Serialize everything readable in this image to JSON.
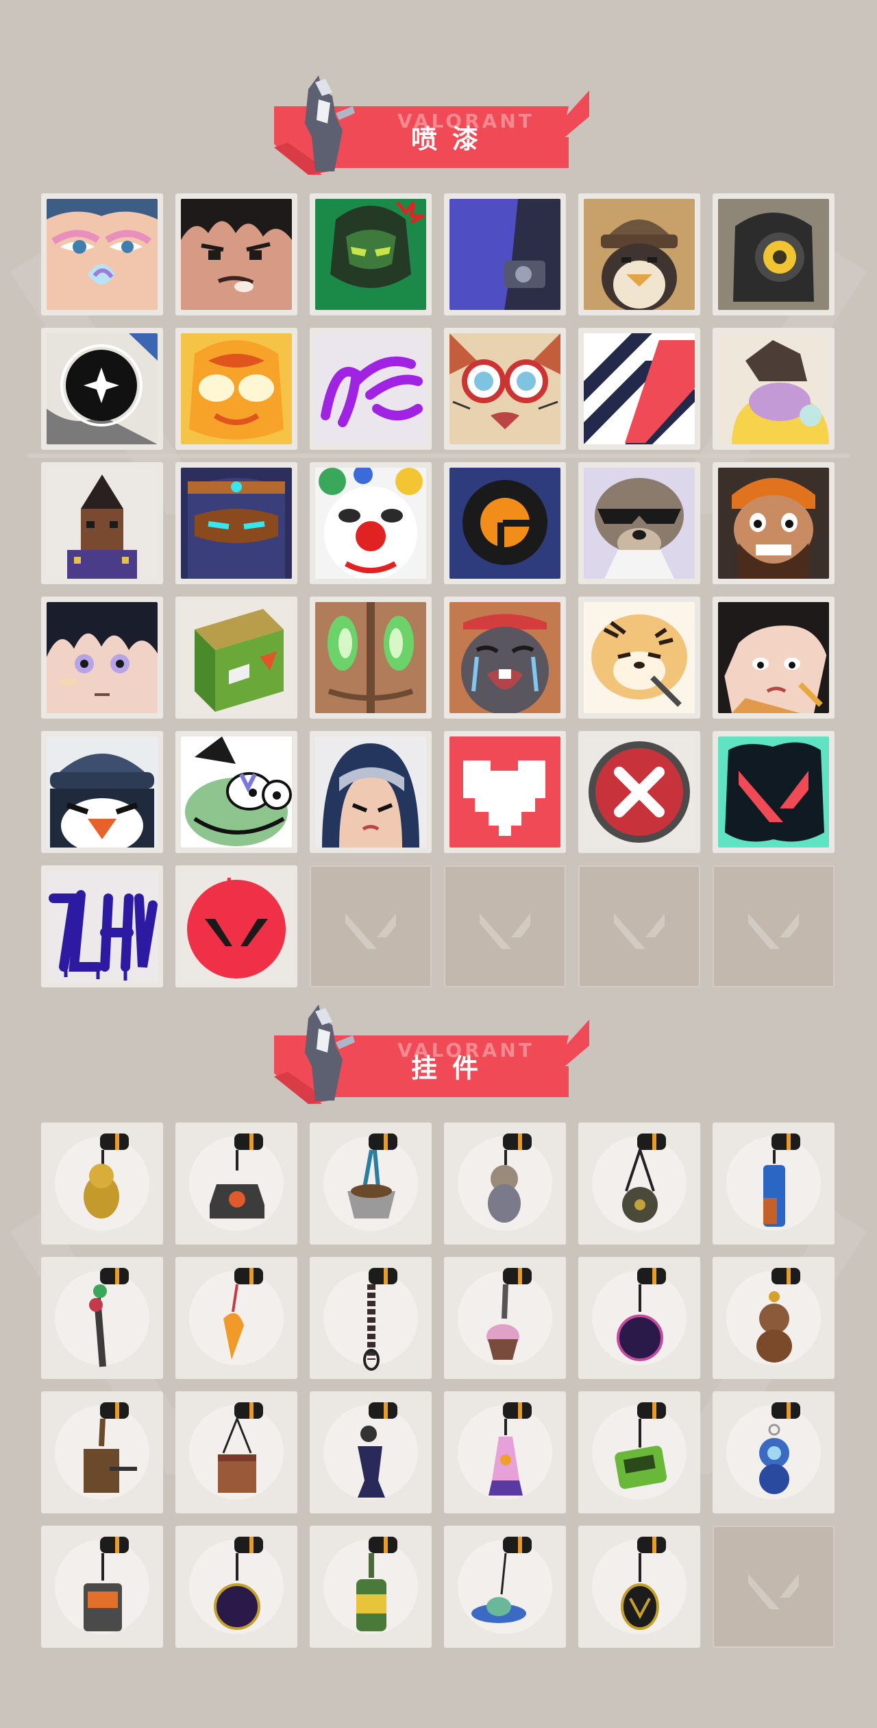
{
  "sections": {
    "sprays": {
      "title": "喷漆",
      "brand": "VALORANT"
    },
    "charms": {
      "title": "挂件",
      "brand": "VALORANT"
    }
  },
  "colors": {
    "background": "#cbc4bd",
    "accent_red": "#ef4a55",
    "tile": "#ebe7e2",
    "empty_tile": "#c2b8ad"
  },
  "sprays": [
    "sage-face-spray",
    "angry-boy-spray",
    "green-soldier-spray",
    "purple-robot-spray",
    "penguin-beanie-spray",
    "camera-bot-spray",
    "sparkle-spray",
    "flame-mask-spray",
    "purple-graffiti-spray",
    "goggles-cat-spray",
    "chevron-logo-spray",
    "sleepy-hat-spray",
    "pixel-warrior-spray",
    "visor-helmet-spray",
    "clown-face-spray",
    "top-hat-spray",
    "raccoon-shades-spray",
    "bearded-man-spray",
    "bandaged-boy-spray",
    "green-crate-spray",
    "green-eyes-spray",
    "crying-mole-spray",
    "tiger-spray",
    "thinking-girl-spray",
    "penguin-angry-spray",
    "frog-hat-spray",
    "hooded-girl-spray",
    "pixel-heart-spray",
    "red-x-spray",
    "valorant-splash-spray",
    "graffiti-tag-spray",
    "red-v-spray"
  ],
  "empty_spray_slots": 4,
  "charms": [
    "gold-cat-charm",
    "camera-drone-charm",
    "teacup-charm",
    "astronaut-cat-charm",
    "round-bag-charm",
    "blue-bottle-charm",
    "chainsaw-charm",
    "guitar-pick-charm",
    "rope-knot-charm",
    "cupcake-charm",
    "ep9-medal-charm",
    "teddy-bear-charm",
    "brown-device-charm",
    "box-charm",
    "figure-charm",
    "lava-lamp-charm",
    "pager-charm",
    "blue-robot-charm",
    "radio-charm",
    "ep9-purple-medal-charm",
    "soda-can-charm",
    "ufo-charm",
    "valorant-coin-charm"
  ],
  "empty_charm_slots": 1
}
